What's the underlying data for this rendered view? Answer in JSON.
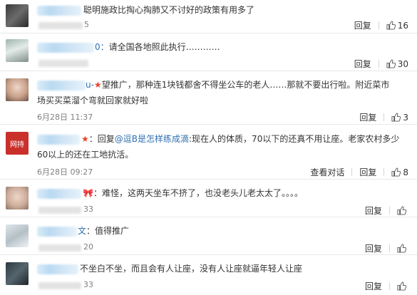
{
  "actions": {
    "reply": "回复",
    "view_thread": "查看对话"
  },
  "comments": [
    {
      "name_tail": "",
      "text": "聪明施政比掏心掏肺又不讨好的政策有用多了",
      "time": "5",
      "likes": "16"
    },
    {
      "name_tail": "0：",
      "text": "请全国各地照此执行…………",
      "time": "",
      "likes": "30"
    },
    {
      "name_tail": "u-",
      "badge": "★",
      "text": "望推广，那种连1块钱都舍不得坐公车的老人……那就不要出行啦。附近菜市",
      "text2": "场买买菜溜个弯就回家就好啦",
      "time": "6月28日 11:37",
      "likes": "3"
    },
    {
      "badge": "★",
      "prefix": "：回复",
      "mention": "@逗B是怎样练成滴",
      "text": ":现在人的体质，70以下的还真不用让座。老家农村多少",
      "text2": "60以上的还在工地抗活。",
      "time": "6月28日 09:27",
      "likes": "8",
      "avatar_text": "网持"
    },
    {
      "badge": "🎀",
      "text": "：难怪，这两天坐车不挤了，也没老头儿老太太了。。。。",
      "time": "33",
      "likes": ""
    },
    {
      "name_tail": "文",
      "text": "：值得推广",
      "time": "20",
      "likes": ""
    },
    {
      "text": "不坐白不坐，而且会有人让座，没有人让座就逼年轻人让座",
      "time": "33",
      "likes": ""
    }
  ],
  "colors": {
    "link": "#2f6fb0",
    "badge": "#e8442b",
    "meta": "#808080"
  },
  "icons": {
    "like": "thumb-up-icon"
  }
}
